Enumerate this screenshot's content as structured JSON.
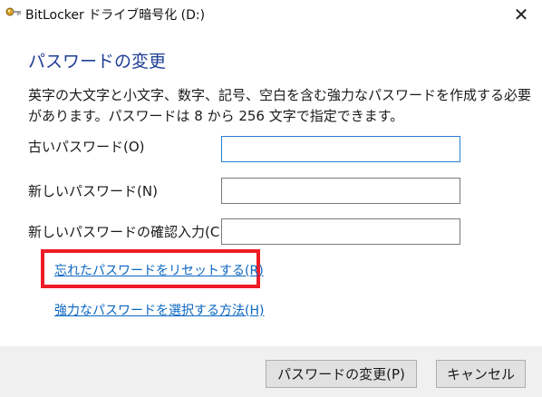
{
  "window": {
    "title": "BitLocker ドライブ暗号化 (D:)",
    "close_label": "✕"
  },
  "main": {
    "heading": "パスワードの変更",
    "description": "英字の大文字と小文字、数字、記号、空白を含む強力なパスワードを作成する必要があります。パスワードは 8 から 256 文字で指定できます。",
    "fields": [
      {
        "label": "古いパスワード(O)",
        "value": ""
      },
      {
        "label": "新しいパスワード(N)",
        "value": ""
      },
      {
        "label": "新しいパスワードの確認入力(C)",
        "value": ""
      }
    ],
    "links": {
      "reset": "忘れたパスワードをリセットする(R)",
      "help": "強力なパスワードを選択する方法(H)"
    }
  },
  "buttons": {
    "change": "パスワードの変更(P)",
    "cancel": "キャンセル"
  },
  "colors": {
    "heading": "#1e3e96",
    "link": "#0a66c2",
    "highlight": "#ee1c25",
    "footer": "#f0f0f0"
  }
}
